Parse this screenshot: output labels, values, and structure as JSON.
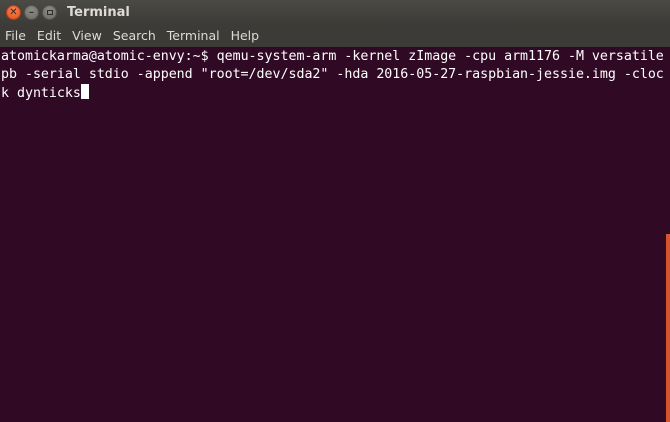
{
  "window": {
    "title": "Terminal",
    "close_glyph": "✕",
    "minimize_glyph": "–"
  },
  "menu": {
    "items": [
      "File",
      "Edit",
      "View",
      "Search",
      "Terminal",
      "Help"
    ]
  },
  "terminal": {
    "prompt": "atomickarma@atomic-envy:~$ ",
    "command": "qemu-system-arm -kernel zImage -cpu arm1176 -M versatilepb -serial stdio -append \"root=/dev/sda2\" -hda 2016-05-27-raspbian-jessie.img -clock dynticks"
  },
  "colors": {
    "background": "#300a24",
    "titlebar": "#3c3b37",
    "text": "#ffffff",
    "close_button": "#df4a16",
    "scrollbar": "#d7532b"
  },
  "icons": {
    "close": "close-icon",
    "minimize": "minimize-icon",
    "maximize": "maximize-icon"
  }
}
